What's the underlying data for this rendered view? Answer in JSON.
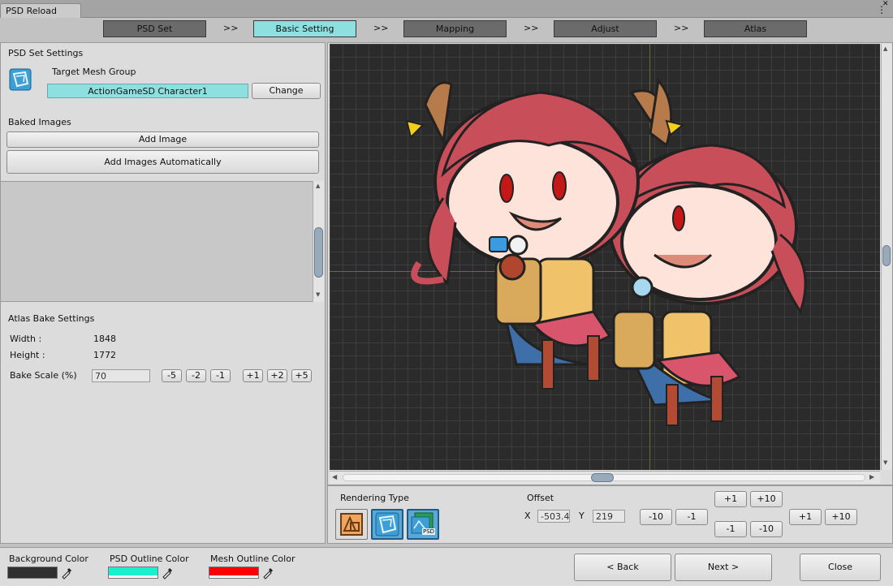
{
  "window": {
    "title": "PSD Reload",
    "kebab_glyph": "⋮",
    "close_glyph": "✕"
  },
  "steps": {
    "items": [
      {
        "label": "PSD Set",
        "active": false
      },
      {
        "label": "Basic Setting",
        "active": true
      },
      {
        "label": "Mapping",
        "active": false
      },
      {
        "label": "Adjust",
        "active": false
      },
      {
        "label": "Atlas",
        "active": false
      }
    ],
    "separator": ">>"
  },
  "psd_set": {
    "header": "PSD Set Settings",
    "target_label": "Target Mesh Group",
    "target_value": "ActionGameSD  Character1",
    "change_button": "Change"
  },
  "baked": {
    "header": "Baked Images",
    "add_image": "Add Image",
    "add_auto": "Add Images Automatically"
  },
  "atlas": {
    "header": "Atlas Bake Settings",
    "width_label": "Width :",
    "width_value": "1848",
    "height_label": "Height :",
    "height_value": "1772",
    "scale_label": "Bake Scale (%)",
    "scale_value": "70",
    "dec_buttons": [
      "-5",
      "-2",
      "-1"
    ],
    "inc_buttons": [
      "+1",
      "+2",
      "+5"
    ]
  },
  "render": {
    "label": "Rendering Type",
    "offset_label": "Offset",
    "x_label": "X",
    "x_value": "-503.4",
    "y_label": "Y",
    "y_value": "219",
    "x_buttons": [
      "-10",
      "-1"
    ],
    "y_top": [
      "+1",
      "+10"
    ],
    "y_bottom": [
      "-1",
      "-10"
    ],
    "x_right": [
      "+1",
      "+10"
    ],
    "psd_badge": "PSD"
  },
  "footer": {
    "bg_color_label": "Background Color",
    "bg_color": "#303030",
    "psd_outline_label": "PSD Outline Color",
    "psd_outline_color": "#19f0cf",
    "mesh_outline_label": "Mesh Outline Color",
    "mesh_outline_color": "#ff0000",
    "back": "< Back",
    "next": "Next >",
    "close": "Close"
  },
  "colors": {
    "accent": "#8ee0e0",
    "step_inactive": "#6b6b6b",
    "canvas_bg": "#2b2b2b",
    "character_hair": "#c84f59"
  }
}
